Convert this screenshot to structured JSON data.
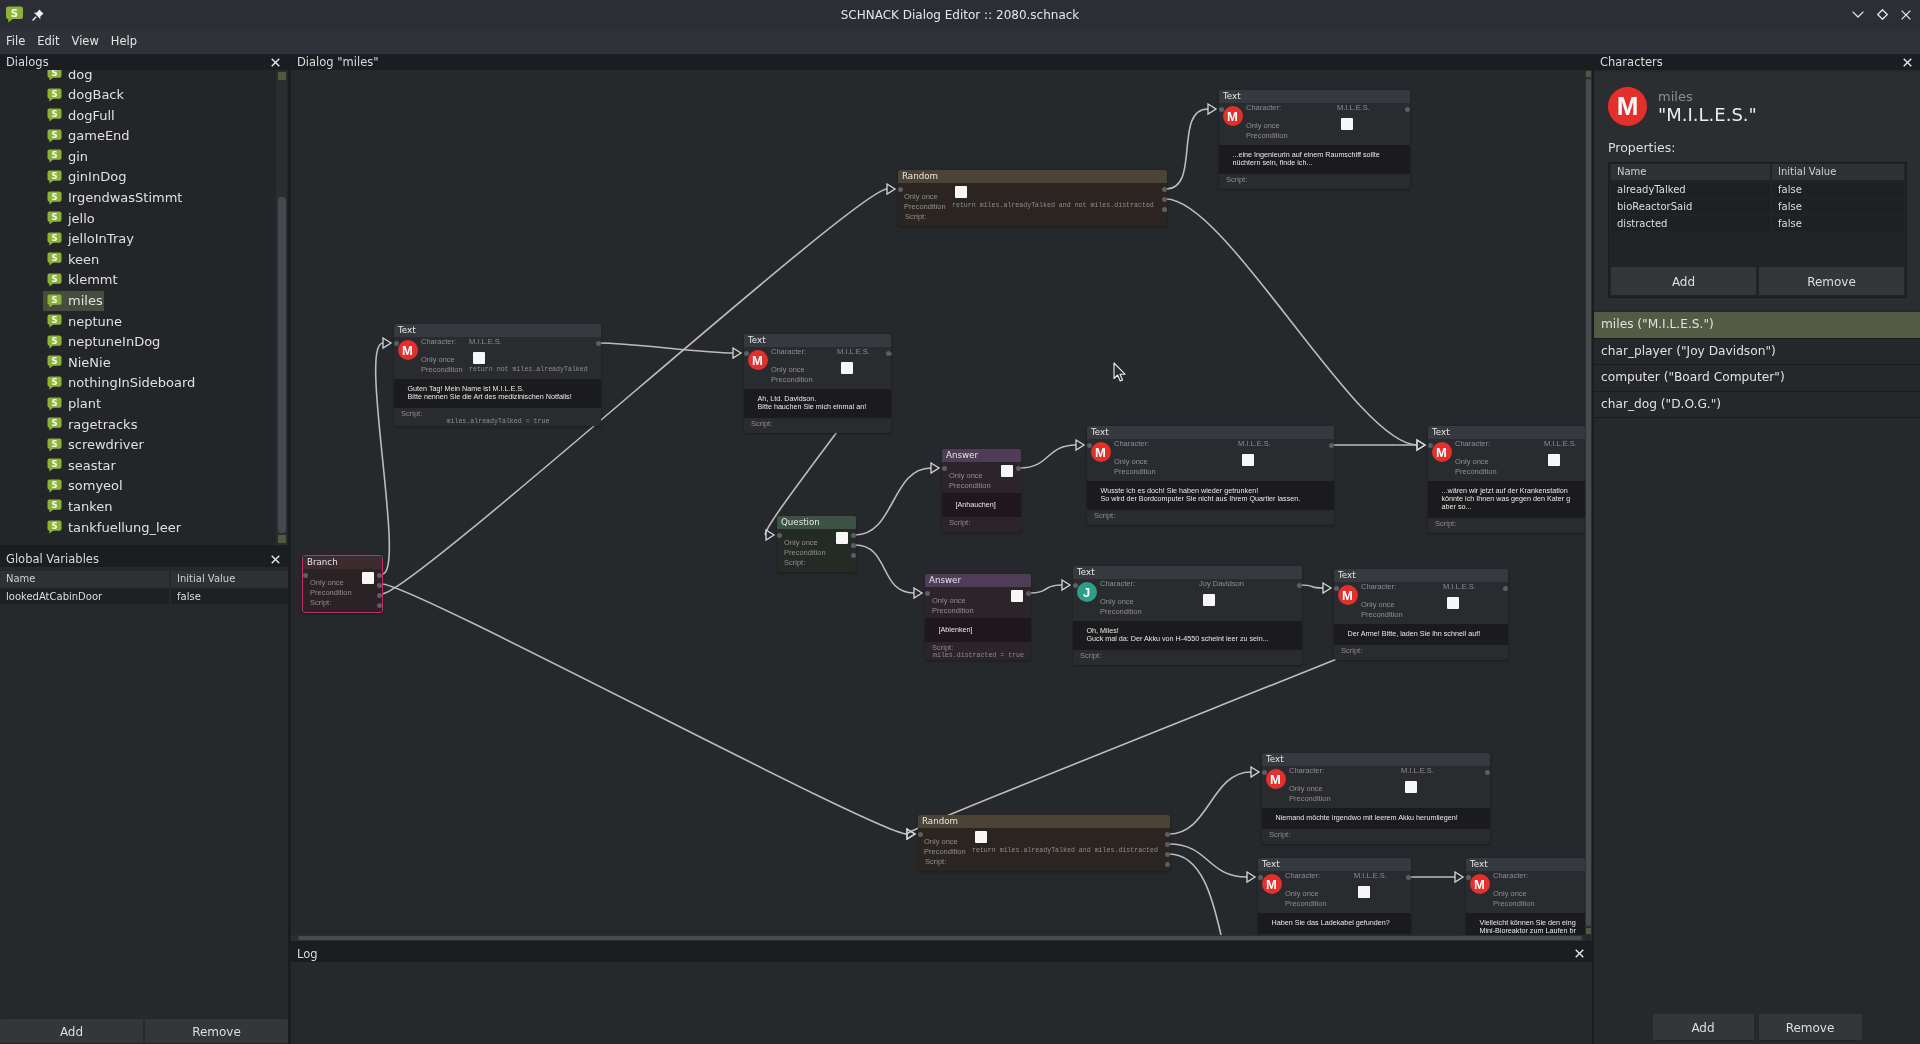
{
  "window": {
    "logo_letter": "S",
    "title": "SCHNACK Dialog Editor :: 2080.schnack"
  },
  "menu": [
    "File",
    "Edit",
    "View",
    "Help"
  ],
  "dialogs_panel": {
    "title": "Dialogs",
    "items": [
      {
        "icon_letter": "S",
        "label": "dog",
        "selected": false
      },
      {
        "icon_letter": "S",
        "label": "dogBack",
        "selected": false
      },
      {
        "icon_letter": "S",
        "label": "dogFull",
        "selected": false
      },
      {
        "icon_letter": "S",
        "label": "gameEnd",
        "selected": false
      },
      {
        "icon_letter": "S",
        "label": "gin",
        "selected": false
      },
      {
        "icon_letter": "S",
        "label": "ginInDog",
        "selected": false
      },
      {
        "icon_letter": "S",
        "label": "IrgendwasStimmt",
        "selected": false
      },
      {
        "icon_letter": "S",
        "label": "jello",
        "selected": false
      },
      {
        "icon_letter": "S",
        "label": "jelloInTray",
        "selected": false
      },
      {
        "icon_letter": "S",
        "label": "keen",
        "selected": false
      },
      {
        "icon_letter": "S",
        "label": "klemmt",
        "selected": false
      },
      {
        "icon_letter": "S",
        "label": "miles",
        "selected": true
      },
      {
        "icon_letter": "S",
        "label": "neptune",
        "selected": false
      },
      {
        "icon_letter": "S",
        "label": "neptuneInDog",
        "selected": false
      },
      {
        "icon_letter": "S",
        "label": "NieNie",
        "selected": false
      },
      {
        "icon_letter": "S",
        "label": "nothingInSideboard",
        "selected": false
      },
      {
        "icon_letter": "S",
        "label": "plant",
        "selected": false
      },
      {
        "icon_letter": "S",
        "label": "ragetracks",
        "selected": false
      },
      {
        "icon_letter": "S",
        "label": "screwdriver",
        "selected": false
      },
      {
        "icon_letter": "S",
        "label": "seastar",
        "selected": false
      },
      {
        "icon_letter": "S",
        "label": "somyeol",
        "selected": false
      },
      {
        "icon_letter": "S",
        "label": "tanken",
        "selected": false
      },
      {
        "icon_letter": "S",
        "label": "tankfuellung_leer",
        "selected": false
      }
    ]
  },
  "global_variables": {
    "title": "Global Variables",
    "columns": [
      "Name",
      "Initial Value"
    ],
    "rows": [
      [
        "lookedAtCabinDoor",
        "false"
      ]
    ],
    "buttons": [
      "Add",
      "Remove"
    ]
  },
  "dialog_view": {
    "title": "Dialog \"miles\"",
    "nodes": [
      {
        "kind": "text",
        "header": "Text",
        "selected": false,
        "avatar": {
          "letter": "M",
          "color": "#e4302b"
        },
        "character_label": "Character:",
        "character": "M.I.L.E.S.",
        "only_once_label": "Only once",
        "only_once": false,
        "precondition_label": "Precondition",
        "lines": [
          "...eine Ingenieurin auf einem Raumschiff sollte",
          "nüchtern sein, finde ich..."
        ],
        "script_label": "Script:"
      },
      {
        "kind": "random",
        "header": "Random",
        "selected": false,
        "only_once_label": "Only once",
        "only_once": false,
        "precondition_label": "Precondition",
        "precondition": "return miles.alreadyTalked and not miles.distracted",
        "script_label": "Script:"
      },
      {
        "kind": "text",
        "header": "Text",
        "selected": false,
        "avatar": {
          "letter": "M",
          "color": "#e4302b"
        },
        "character_label": "Character:",
        "character": "M.I.L.E.S.",
        "only_once_label": "Only once",
        "only_once": false,
        "precondition_label": "Precondition",
        "precondition": "return not miles.alreadyTalked",
        "lines": [
          "Guten Tag! Mein Name ist M.I.L.E.S.",
          "Bitte nennen Sie die Art des medizinischen Notfalls!"
        ],
        "script_label": "Script:",
        "script": "miles.alreadyTalked = true"
      },
      {
        "kind": "text",
        "header": "Text",
        "selected": false,
        "avatar": {
          "letter": "M",
          "color": "#e4302b"
        },
        "character_label": "Character:",
        "character": "M.I.L.E.S.",
        "only_once_label": "Only once",
        "only_once": false,
        "precondition_label": "Precondition",
        "lines": [
          "Ah, Ltd. Davidson.",
          "Bitte hauchen Sie mich einmal an!"
        ],
        "script_label": "Script:"
      },
      {
        "kind": "answer",
        "header": "Answer",
        "selected": false,
        "only_once_label": "Only once",
        "only_once": false,
        "precondition_label": "Precondition",
        "lines": [
          "[Anhauchen]"
        ],
        "script_label": "Script:"
      },
      {
        "kind": "text",
        "header": "Text",
        "selected": false,
        "avatar": {
          "letter": "M",
          "color": "#e4302b"
        },
        "character_label": "Character:",
        "character": "M.I.L.E.S.",
        "only_once_label": "Only once",
        "only_once": false,
        "precondition_label": "Precondition",
        "lines": [
          "Wusste ich es doch! Sie haben wieder getrunken!",
          "So wird der Bordcomputer Sie nicht aus Ihrem Quartier lassen."
        ],
        "script_label": "Script:"
      },
      {
        "kind": "text",
        "header": "Text",
        "selected": false,
        "avatar": {
          "letter": "M",
          "color": "#e4302b"
        },
        "character_label": "Character:",
        "character": "M.I.L.E.S.",
        "only_once_label": "Only once",
        "only_once": false,
        "precondition_label": "Precondition",
        "lines": [
          "...wären wir jetzt auf der Krankenstation",
          "könnte ich Ihnen was gegen den Kater g",
          "aber so..."
        ],
        "script_label": "Script:"
      },
      {
        "kind": "question",
        "header": "Question",
        "selected": false,
        "only_once_label": "Only once",
        "only_once": false,
        "precondition_label": "Precondition",
        "script_label": "Script:"
      },
      {
        "kind": "branch",
        "header": "Branch",
        "selected": true,
        "only_once_label": "Only once",
        "only_once": false,
        "precondition_label": "Precondition",
        "script_label": "Script:"
      },
      {
        "kind": "answer",
        "header": "Answer",
        "selected": false,
        "only_once_label": "Only once",
        "only_once": false,
        "precondition_label": "Precondition",
        "lines": [
          "[Ablenken]"
        ],
        "script_label": "Script:",
        "script": "miles.distracted = true"
      },
      {
        "kind": "text",
        "header": "Text",
        "selected": false,
        "avatar": {
          "letter": "J",
          "color": "#2e9e89"
        },
        "character_label": "Character:",
        "character": "Joy Davidson",
        "only_once_label": "Only once",
        "only_once": false,
        "precondition_label": "Precondition",
        "lines": [
          "Oh, Miles!",
          "Guck mal da: Der Akku von H-4550 scheint leer zu sein..."
        ],
        "script_label": "Script:"
      },
      {
        "kind": "text",
        "header": "Text",
        "selected": false,
        "avatar": {
          "letter": "M",
          "color": "#e4302b"
        },
        "character_label": "Character:",
        "character": "M.I.L.E.S.",
        "only_once_label": "Only once",
        "only_once": false,
        "precondition_label": "Precondition",
        "lines": [
          "Der Arme! Bitte, laden Sie ihn schnell auf!"
        ],
        "script_label": "Script:"
      },
      {
        "kind": "text",
        "header": "Text",
        "selected": false,
        "avatar": {
          "letter": "M",
          "color": "#e4302b"
        },
        "character_label": "Character:",
        "character": "M.I.L.E.S.",
        "only_once_label": "Only once",
        "only_once": false,
        "precondition_label": "Precondition",
        "lines": [
          "Niemand möchte irgendwo mit leerem Akku herumliegen!"
        ],
        "script_label": "Script:"
      },
      {
        "kind": "random",
        "header": "Random",
        "selected": false,
        "only_once_label": "Only once",
        "only_once": false,
        "precondition_label": "Precondition",
        "precondition": "return miles.alreadyTalked and miles.distracted",
        "script_label": "Script:"
      },
      {
        "kind": "text",
        "header": "Text",
        "selected": false,
        "avatar": {
          "letter": "M",
          "color": "#e4302b"
        },
        "character_label": "Character:",
        "character": "M.I.L.E.S.",
        "only_once_label": "Only once",
        "only_once": false,
        "precondition_label": "Precondition",
        "lines": [
          "Haben Sie das Ladekabel gefunden?"
        ]
      },
      {
        "kind": "text",
        "header": "Text",
        "selected": false,
        "avatar": {
          "letter": "M",
          "color": "#e4302b"
        },
        "character_label": "Character:",
        "only_once_label": "Only once",
        "precondition_label": "Precondition",
        "lines": [
          "Vielleicht können Sie den eing",
          "Mini-Bioreaktor zum Laufen br"
        ]
      }
    ]
  },
  "log": {
    "title": "Log"
  },
  "characters_panel": {
    "title": "Characters",
    "current": {
      "avatar": {
        "letter": "M",
        "color": "#e4302b"
      },
      "name": "miles",
      "display_name": "\"M.I.L.E.S.\""
    },
    "properties_label": "Properties:",
    "properties": {
      "columns": [
        "Name",
        "Initial Value"
      ],
      "rows": [
        [
          "alreadyTalked",
          "false"
        ],
        [
          "bioReactorSaid",
          "false"
        ],
        [
          "distracted",
          "false"
        ]
      ],
      "buttons": [
        "Add",
        "Remove"
      ]
    },
    "list": [
      {
        "label": "miles (\"M.I.L.E.S.\")",
        "selected": true
      },
      {
        "label": "char_player (\"Joy Davidson\")",
        "selected": false
      },
      {
        "label": "computer (\"Board Computer\")",
        "selected": false
      },
      {
        "label": "char_dog (\"D.O.G.\")",
        "selected": false
      }
    ],
    "buttons": [
      "Add",
      "Remove"
    ]
  }
}
